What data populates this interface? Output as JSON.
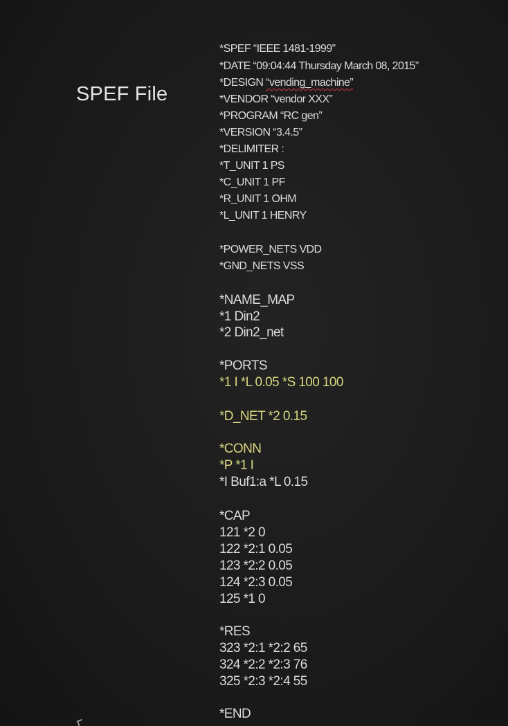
{
  "title": "SPEF File",
  "header": {
    "spef": "*SPEF “IEEE 1481-1999”",
    "date": "*DATE “09:04:44 Thursday March 08, 2015”",
    "design_prefix": "*DESIGN ",
    "design_value": "“vending_machine”",
    "vendor": "*VENDOR “vendor XXX”",
    "program": "*PROGRAM “RC gen”",
    "version": "*VERSION “3.4.5”",
    "delimiter": "*DELIMITER :",
    "t_unit": "*T_UNIT 1 PS",
    "c_unit": "*C_UNIT 1 PF",
    "r_unit": "*R_UNIT 1 OHM",
    "l_unit": "*L_UNIT 1 HENRY"
  },
  "nets": {
    "power": "*POWER_NETS VDD",
    "gnd": "*GND_NETS VSS"
  },
  "name_map": {
    "heading": "*NAME_MAP",
    "entries": [
      "*1 Din2",
      "*2 Din2_net"
    ]
  },
  "ports": {
    "heading": "*PORTS",
    "entries": [
      "*1 I *L 0.05 *S 100 100"
    ]
  },
  "d_net": "*D_NET *2 0.15",
  "conn": {
    "heading": "*CONN",
    "entries": [
      "*P *1 I",
      "*I Buf1:a *L 0.15"
    ]
  },
  "cap": {
    "heading": "*CAP",
    "entries": [
      "121 *2 0",
      "122 *2:1 0.05",
      "123 *2:2 0.05",
      "124 *2:3 0.05",
      "125 *1 0"
    ]
  },
  "res": {
    "heading": "*RES",
    "entries": [
      "323 *2:1 *2:2 65",
      "324 *2:2 *2:3 76",
      "325 *2:3 *2:4 55"
    ]
  },
  "end": "*END",
  "colors": {
    "background": "#1b1b1b",
    "text": "#dcdcdc",
    "highlight": "#d7d67f",
    "spellcheck_underline": "#d23a3a"
  }
}
